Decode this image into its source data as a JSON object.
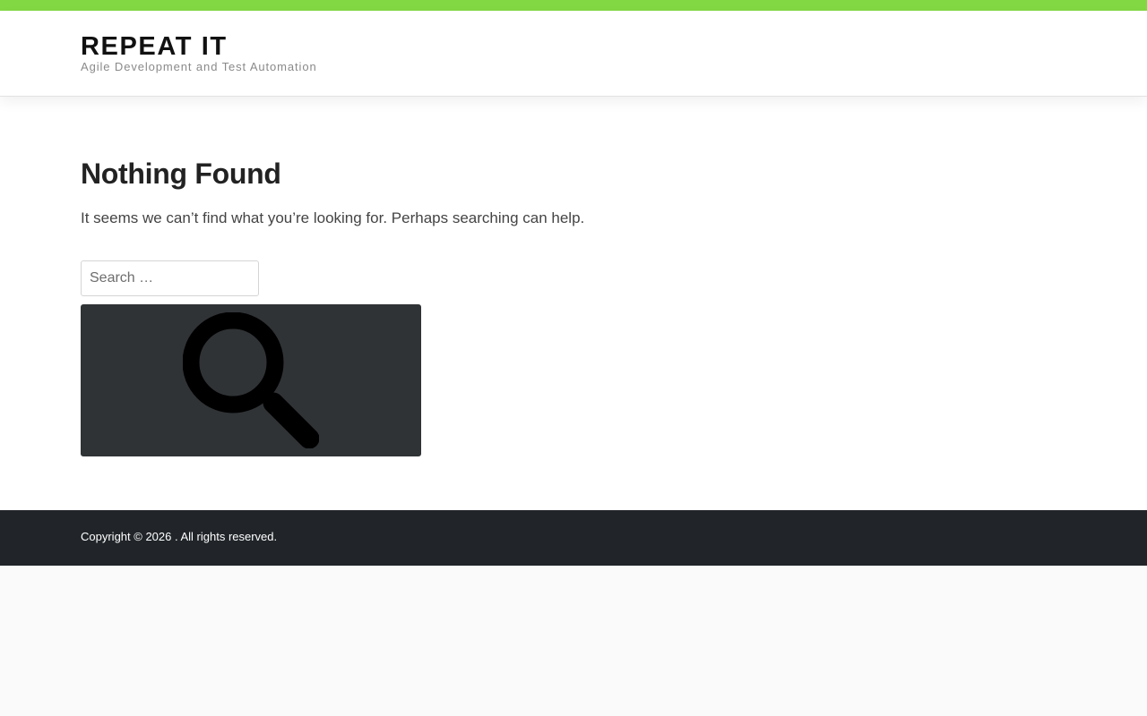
{
  "header": {
    "site_title": "REPEAT IT",
    "tagline": "Agile Development and Test Automation",
    "accent_color": "#82d843"
  },
  "main": {
    "title": "Nothing Found",
    "message": "It seems we can’t find what you’re looking for. Perhaps searching can help.",
    "search": {
      "placeholder": "Search …",
      "value": "",
      "button_icon": "search-icon"
    }
  },
  "footer": {
    "copyright": "Copyright © 2026 . All rights reserved.",
    "background_color": "#212529"
  }
}
